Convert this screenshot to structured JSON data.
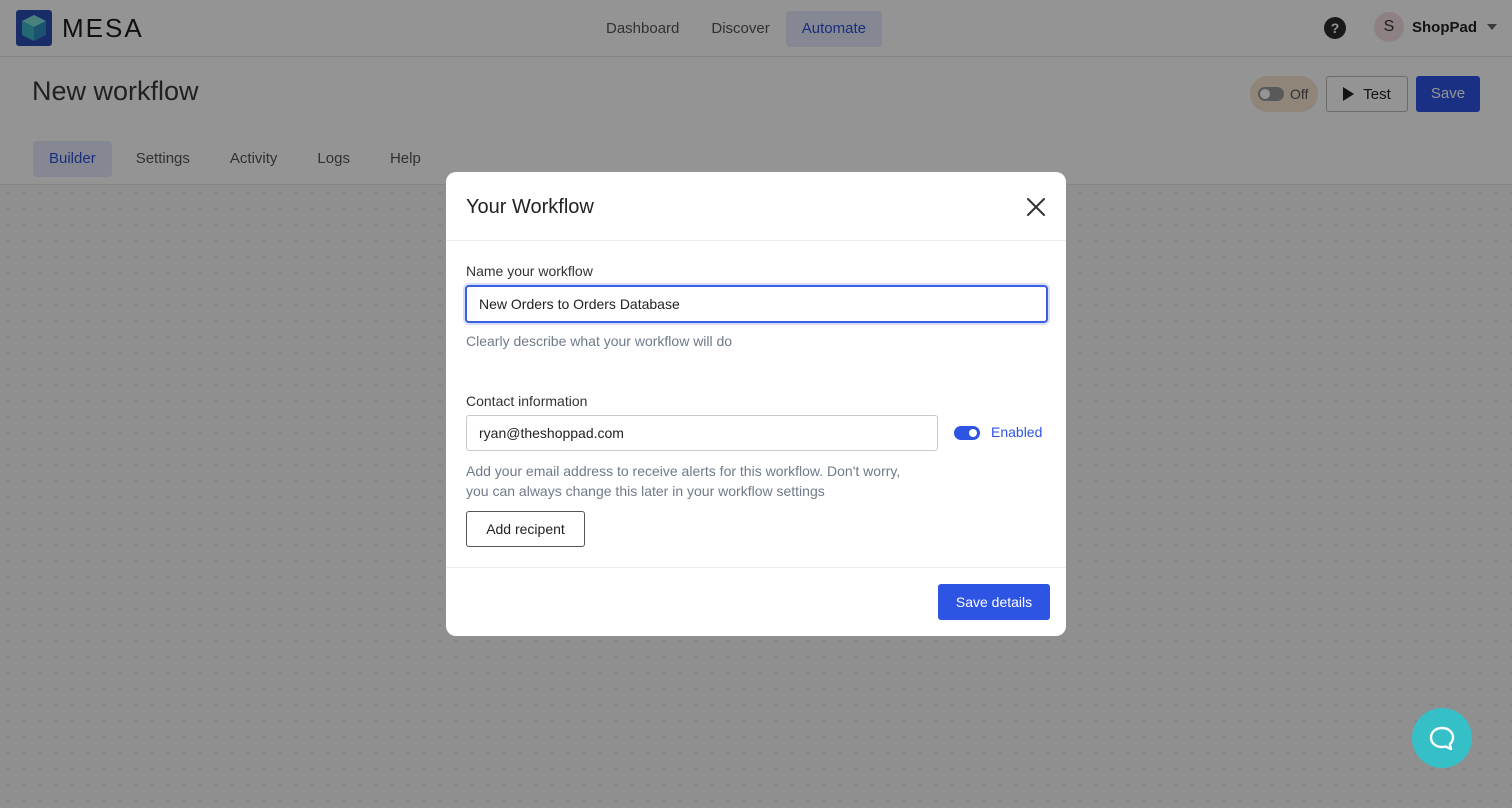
{
  "brand": {
    "name": "MESA"
  },
  "nav": {
    "items": [
      {
        "label": "Dashboard",
        "active": false
      },
      {
        "label": "Discover",
        "active": false
      },
      {
        "label": "Automate",
        "active": true
      }
    ]
  },
  "user": {
    "initial": "S",
    "name": "ShopPad"
  },
  "page": {
    "title": "New workflow",
    "status_label": "Off",
    "test_label": "Test",
    "save_label": "Save"
  },
  "tabs": [
    {
      "label": "Builder",
      "active": true
    },
    {
      "label": "Settings",
      "active": false
    },
    {
      "label": "Activity",
      "active": false
    },
    {
      "label": "Logs",
      "active": false
    },
    {
      "label": "Help",
      "active": false
    }
  ],
  "modal": {
    "title": "Your Workflow",
    "name_label": "Name your workflow",
    "name_value": "New Orders to Orders Database",
    "name_hint": "Clearly describe what your workflow will do",
    "contact_label": "Contact information",
    "email_value": "ryan@theshoppad.com",
    "enabled_label": "Enabled",
    "contact_hint_line1": "Add your email address to receive alerts for this workflow. Don't worry,",
    "contact_hint_line2": "you can always change this later in your workflow settings",
    "add_recipient_label": "Add recipent",
    "save_details_label": "Save details"
  },
  "colors": {
    "accent": "#2e54e3",
    "chat": "#35c0c7",
    "toggle_off_bg": "#f7e5cf"
  },
  "icons": [
    "mesa-logo-icon",
    "help-icon",
    "chevron-down-icon",
    "play-icon",
    "close-icon",
    "chat-icon"
  ]
}
